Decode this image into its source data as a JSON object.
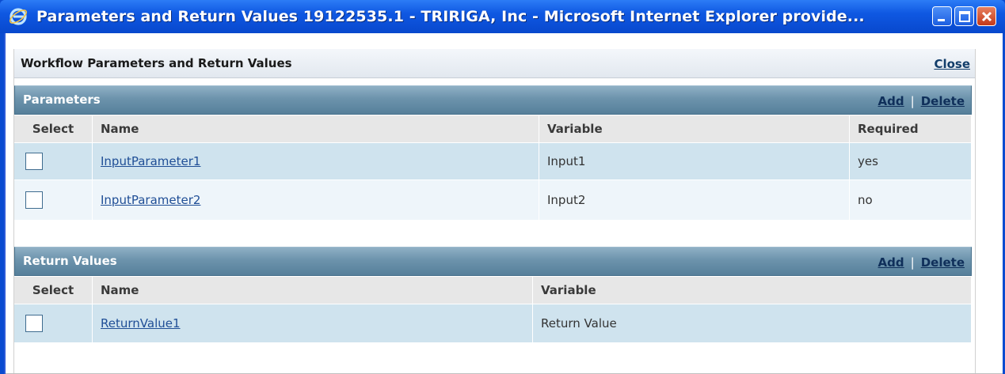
{
  "window": {
    "title": "Parameters and Return Values 19122535.1 - TRIRIGA, Inc - Microsoft Internet Explorer provide...",
    "title_bar_color": "#0f58e2"
  },
  "dialog": {
    "title": "Workflow Parameters and Return Values",
    "close_label": "Close"
  },
  "parameters": {
    "title": "Parameters",
    "add_label": "Add",
    "separator": "|",
    "delete_label": "Delete",
    "columns": [
      "Select",
      "Name",
      "Variable",
      "Required"
    ],
    "rows": [
      {
        "name": "InputParameter1",
        "variable": "Input1",
        "required": "yes"
      },
      {
        "name": "InputParameter2",
        "variable": "Input2",
        "required": "no"
      }
    ]
  },
  "return_values": {
    "title": "Return Values",
    "add_label": "Add",
    "separator": "|",
    "delete_label": "Delete",
    "columns": [
      "Select",
      "Name",
      "Variable"
    ],
    "rows": [
      {
        "name": "ReturnValue1",
        "variable": "Return Value"
      }
    ]
  },
  "colors": {
    "section_bar": "#6c93ac",
    "row_highlight": "#cfe3ee",
    "row_alt": "#eef5fa",
    "link": "#1f4e96"
  }
}
